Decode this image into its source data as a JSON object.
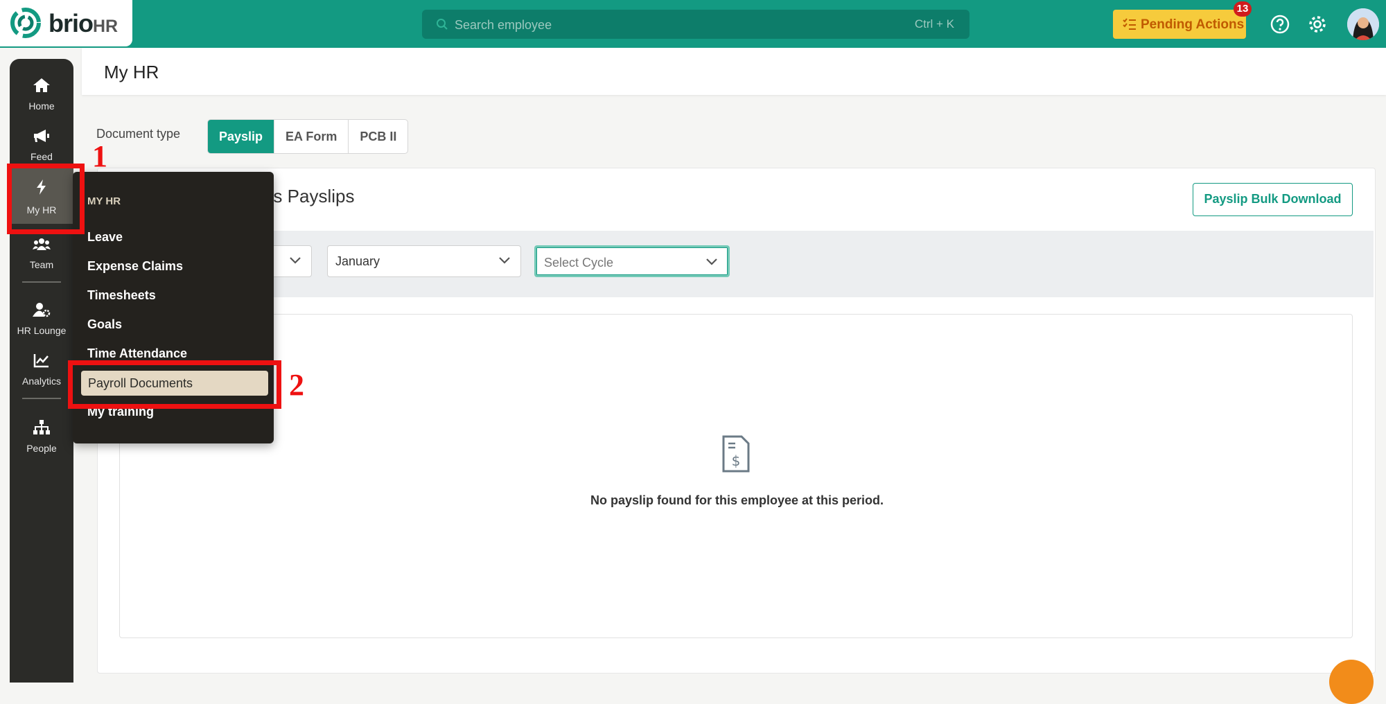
{
  "brand": {
    "name": "brio",
    "suffix": "HR"
  },
  "search": {
    "placeholder": "Search employee",
    "shortcut": "Ctrl + K"
  },
  "header_actions": {
    "pending_label": "Pending Actions",
    "pending_count": "13"
  },
  "rail": {
    "items": [
      {
        "label": "Home"
      },
      {
        "label": "Feed"
      },
      {
        "label": "My HR"
      },
      {
        "label": "Team"
      },
      {
        "label": "HR Lounge"
      },
      {
        "label": "Analytics"
      },
      {
        "label": "People"
      }
    ]
  },
  "menu": {
    "title": "MY HR",
    "items": [
      "Leave",
      "Expense Claims",
      "Timesheets",
      "Goals",
      "Time Attendance",
      "Payroll Documents",
      "My training"
    ]
  },
  "annotations": {
    "one": "1",
    "two": "2"
  },
  "page": {
    "title": "My HR"
  },
  "doc_type": {
    "label": "Document type",
    "options": [
      "Payslip",
      "EA Form",
      "PCB II"
    ],
    "selected": "Payslip"
  },
  "payslips": {
    "title_visible": "n's Payslips",
    "bulk_download": "Payslip Bulk Download",
    "month": "January",
    "cycle_placeholder": "Select Cycle",
    "empty_message": "No payslip found for this employee at this period."
  },
  "colors": {
    "brand": "#139a82",
    "pending": "#f6cb3c",
    "annotation": "#ee1111"
  }
}
